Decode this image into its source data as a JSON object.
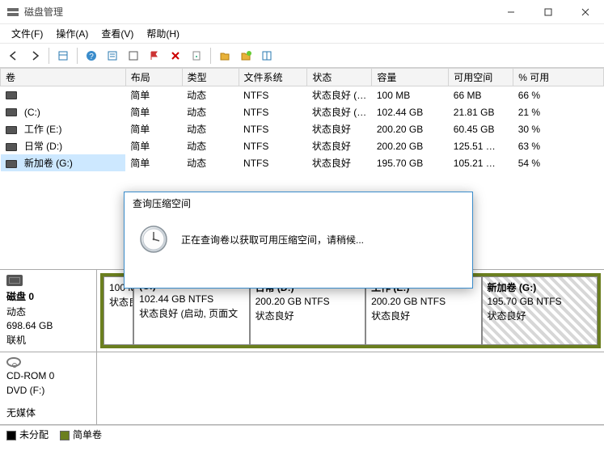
{
  "window": {
    "title": "磁盘管理"
  },
  "menus": [
    "文件(F)",
    "操作(A)",
    "查看(V)",
    "帮助(H)"
  ],
  "columns": [
    "卷",
    "布局",
    "类型",
    "文件系统",
    "状态",
    "容量",
    "可用空间",
    "% 可用"
  ],
  "rows": [
    {
      "name": "",
      "layout": "简单",
      "type": "动态",
      "fs": "NTFS",
      "status": "状态良好 (…",
      "cap": "100 MB",
      "free": "66 MB",
      "pct": "66 %"
    },
    {
      "name": " (C:)",
      "layout": "简单",
      "type": "动态",
      "fs": "NTFS",
      "status": "状态良好 (…",
      "cap": "102.44 GB",
      "free": "21.81 GB",
      "pct": "21 %"
    },
    {
      "name": " 工作 (E:)",
      "layout": "简单",
      "type": "动态",
      "fs": "NTFS",
      "status": "状态良好",
      "cap": "200.20 GB",
      "free": "60.45 GB",
      "pct": "30 %"
    },
    {
      "name": " 日常 (D:)",
      "layout": "简单",
      "type": "动态",
      "fs": "NTFS",
      "status": "状态良好",
      "cap": "200.20 GB",
      "free": "125.51 …",
      "pct": "63 %"
    },
    {
      "name": " 新加卷 (G:)",
      "layout": "简单",
      "type": "动态",
      "fs": "NTFS",
      "status": "状态良好",
      "cap": "195.70 GB",
      "free": "105.21 …",
      "pct": "54 %",
      "selected": true
    }
  ],
  "disk0": {
    "title": "磁盘 0",
    "type": "动态",
    "size": "698.64 GB",
    "state": "联机",
    "parts": [
      {
        "title": "",
        "size": "100 M",
        "status": "状态良",
        "flex": 0.25,
        "hatched": false
      },
      {
        "title": "(C:)",
        "size": "102.44 GB NTFS",
        "status": "状态良好 (启动, 页面文",
        "flex": 1.4,
        "hatched": false
      },
      {
        "title": "日常  (D:)",
        "size": "200.20 GB NTFS",
        "status": "状态良好",
        "flex": 1.4,
        "hatched": false
      },
      {
        "title": "工作  (E:)",
        "size": "200.20 GB NTFS",
        "status": "状态良好",
        "flex": 1.4,
        "hatched": false
      },
      {
        "title": "新加卷  (G:)",
        "size": "195.70 GB NTFS",
        "status": "状态良好",
        "flex": 1.4,
        "hatched": true
      }
    ]
  },
  "cdrom": {
    "title": "CD-ROM 0",
    "sub": "DVD (F:)",
    "state": "无媒体"
  },
  "legend": {
    "unalloc": "未分配",
    "simple": "简单卷"
  },
  "dialog": {
    "title": "查询压缩空间",
    "message": "正在查询卷以获取可用压缩空间，请稍候..."
  }
}
